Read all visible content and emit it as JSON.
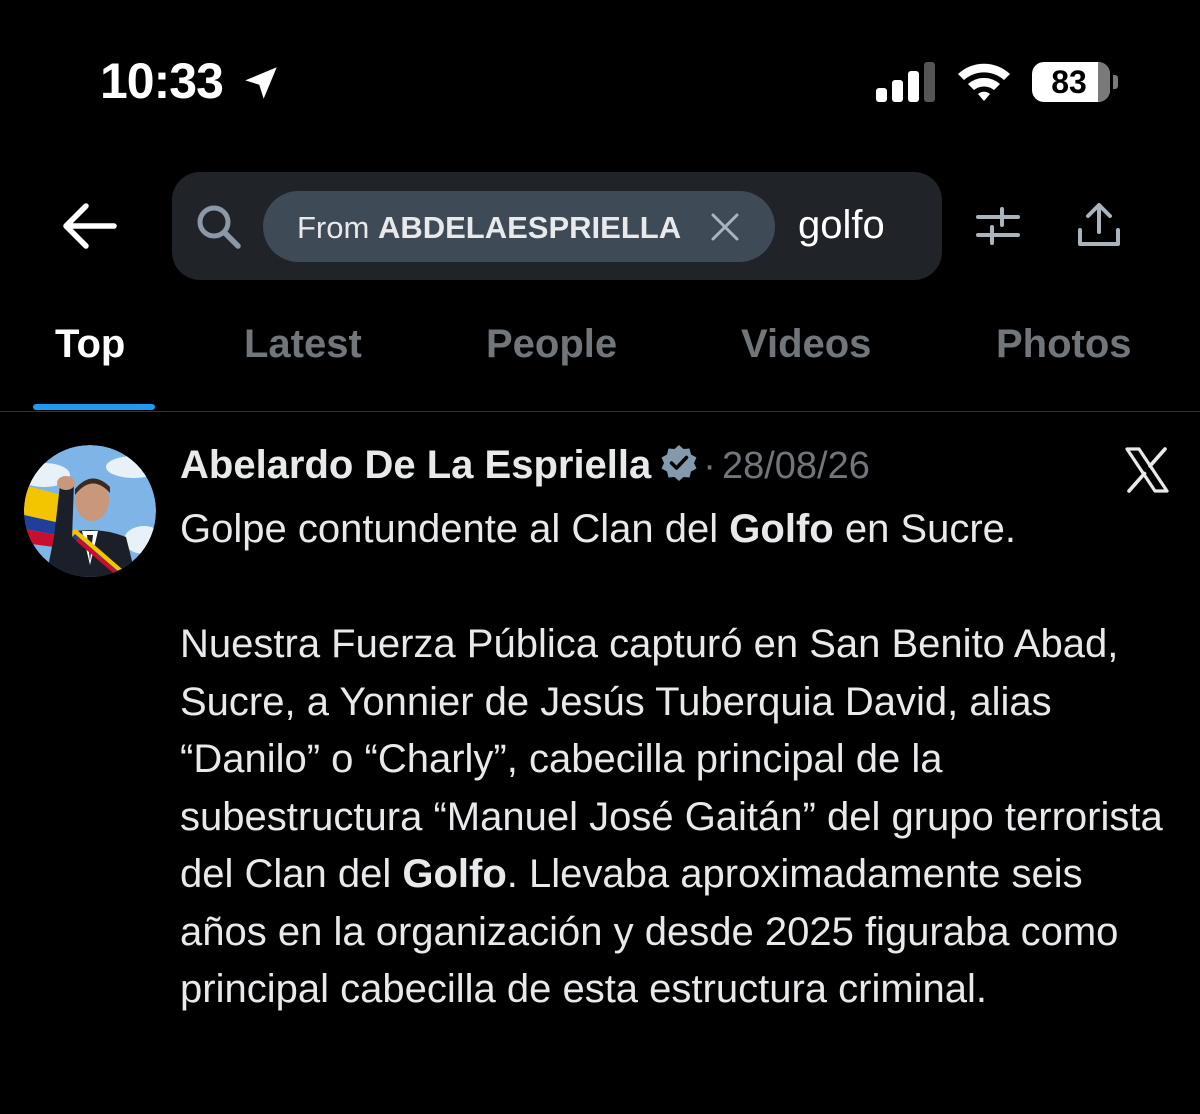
{
  "status_bar": {
    "time": "10:33",
    "battery": "83",
    "icons": [
      "location-arrow-icon",
      "cellular-signal-icon",
      "wifi-icon",
      "battery-icon"
    ]
  },
  "search": {
    "chip_prefix": "From",
    "chip_user": "ABDELAESPRIELLA",
    "query": "golfo",
    "icons": [
      "back-arrow-icon",
      "search-icon",
      "close-icon",
      "filter-sliders-icon",
      "share-icon"
    ]
  },
  "tabs": [
    {
      "label": "Top",
      "active": true
    },
    {
      "label": "Latest",
      "active": false
    },
    {
      "label": "People",
      "active": false
    },
    {
      "label": "Videos",
      "active": false
    },
    {
      "label": "Photos",
      "active": false
    }
  ],
  "tweet": {
    "author": "Abelardo De La Espriella",
    "separator": "·",
    "date": "28/08/26",
    "verified": true,
    "line1_pre": "Golpe contundente al Clan del ",
    "line1_bold": "Golfo",
    "line1_post": " en Sucre.",
    "line2_pre": "Nuestra Fuerza Pública capturó en San Benito Abad, Sucre, a Yonnier de Jesús Tuberquia David, alias “Danilo” o “Charly”, cabecilla principal de la subestructura “Manuel José Gaitán” del grupo terrorista del Clan del ",
    "line2_bold": "Golfo",
    "line2_post": ". Llevaba aproximadamente seis años en la organización y desde 2025 figuraba como principal cabecilla de esta estructura criminal."
  },
  "colors": {
    "background": "#000000",
    "text": "#e7e9ea",
    "muted": "#71767b",
    "search_bg": "#202327",
    "chip_bg": "#3e4a55",
    "accent": "#1d9bf0"
  }
}
